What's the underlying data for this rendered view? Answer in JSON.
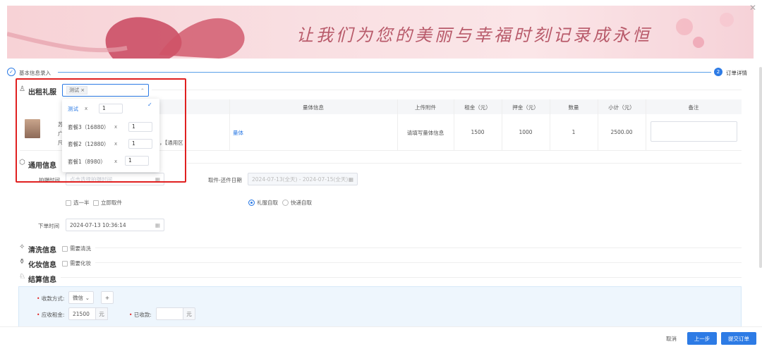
{
  "banner": {
    "title": "让我们为您的美丽与幸福时刻记录成永恒"
  },
  "steps": [
    {
      "label": "基本信息录入",
      "num": ""
    },
    {
      "label": "订单详情",
      "num": "2"
    }
  ],
  "rental": {
    "title": "出租礼服",
    "selected_tag": "测试",
    "dropdown": [
      {
        "label": "测试",
        "qty": "1",
        "selected": true,
        "x": "x"
      },
      {
        "label": "套餐3（16880）",
        "qty": "1",
        "selected": false,
        "x": "x"
      },
      {
        "label": "套餐2（12880）",
        "qty": "1",
        "selected": false,
        "x": "x"
      },
      {
        "label": "套餐1（8980）",
        "qty": "1",
        "selected": false,
        "x": "x"
      }
    ],
    "table": {
      "headers": [
        "量体信息",
        "上传附件",
        "租金（元）",
        "押金（元）",
        "数量",
        "小计（元）",
        "备注"
      ],
      "row": {
        "name_partial": "苏",
        "line2": "广",
        "line3": "尺",
        "tag": "，【通用区",
        "measure_link": "量体",
        "attachment": "请填写量体信息",
        "rent": "1500",
        "deposit": "1000",
        "qty": "1",
        "subtotal": "2500.00"
      }
    }
  },
  "general": {
    "title": "通用信息",
    "shoot_time_label": "拍摄时间",
    "shoot_time_placeholder": "点击选择拍摄时间",
    "pickup_label": "取件-还件日期",
    "pickup_value": "2024-07-13(全天) - 2024-07-15(全天)",
    "cb_half": "选一半",
    "cb_now": "立即取件",
    "radio_self": "礼服自取",
    "radio_express": "快递自取",
    "order_time_label": "下单时间",
    "order_time_value": "2024-07-13 10:36:14"
  },
  "clean": {
    "title": "清洗信息",
    "checkbox": "需要清洗"
  },
  "makeup": {
    "title": "化妆信息",
    "checkbox": "需要化妆"
  },
  "settle": {
    "title": "结算信息",
    "pay_method_label": "收款方式:",
    "pay_method_value": "微信",
    "add_label": "+",
    "receivable_label": "应收租金:",
    "receivable_value": "21500",
    "unit": "元",
    "received_label": "已收款:",
    "received_value": ""
  },
  "footer": {
    "cancel": "取消",
    "prev": "上一步",
    "submit": "提交订单"
  },
  "colors": {
    "primary": "#2d7be5",
    "highlight": "#e02020"
  }
}
